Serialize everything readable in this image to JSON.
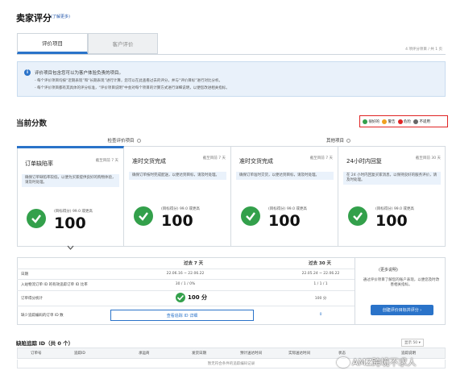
{
  "header": {
    "title": "卖家评分",
    "subtitle": "(了解更多)"
  },
  "tabs": [
    {
      "label": "评价项目"
    },
    {
      "label": "客户评价"
    }
  ],
  "meta_right": "4 项评分项目 / 共 1 页",
  "info": {
    "title": "评价项目包含您可以为客户体验负责的项目。",
    "lines": [
      "- 每个评价项目均按“近期表现”和“长期表现”进行计算，您可以在此查看过去的评分，并与“评价目标”进行对比分析。",
      "- 每个评价项目都有其具体的评分标准，“评价项目说明”中会对每个项目的计算方式进行详细说明，以便您改进相关指标。"
    ]
  },
  "section_title": "当前分数",
  "legend": [
    {
      "label": "很好的",
      "color": "#33a04b"
    },
    {
      "label": "警告",
      "color": "#f0a020"
    },
    {
      "label": "危险",
      "color": "#e02424"
    },
    {
      "label": "不适用",
      "color": "#666666"
    }
  ],
  "groups": [
    {
      "label": "检查评价项目"
    },
    {
      "label": "其他项目"
    }
  ],
  "cards": [
    {
      "name": "订单缺陷率",
      "target": "截至目前 7 天",
      "desc": "确保订单缺陷率较低，以便为买家提供良好的购物体验，请及时处理。",
      "score": "100",
      "score_caption": "(目标得分) 99.0 或更高"
    },
    {
      "name": "准时交货完成",
      "target": "截至目前 7 天",
      "desc": "确保订单按时完成配送，以便达到目标，请及时处理。",
      "score": "100",
      "score_caption": "(目标得分) 99.0 或更高"
    },
    {
      "name": "准时交货完成",
      "target": "截至目前 7 天",
      "desc": "确保订单准时交货，以便达到目标，请及时处理。",
      "score": "100",
      "score_caption": "(目标得分) 99.0 或更高"
    },
    {
      "name": "24小时内回复",
      "target": "截至目前 30 天",
      "desc": "在 24 小时内回复买家消息，以保持良好的服务评价，请及时处理。",
      "score": "100",
      "score_caption": "(目标得分) 99.0 或更高"
    }
  ],
  "table": {
    "col_headers": [
      "过去 7 天",
      "过去 30 天"
    ],
    "side_title": "(更多说明)",
    "side_desc": "通过评价项目了解您的账户表现，以便您及时改善相关指标。",
    "side_button": "创建评价目标并评分 ›",
    "rows": [
      {
        "label": "日期",
        "v7": "22.06.16 ~ 22.06.22",
        "v30": "22.05.24 ~ 22.06.22"
      },
      {
        "label": "入站物流订单 ID 的有效追踪订单 ID 比率",
        "v7": "30 / 1 / 0%",
        "v30": "1 / 1 / 1"
      },
      {
        "label": "订单得分统计",
        "v7": "100 分",
        "v30": "100 分"
      },
      {
        "label": "缺少追踪编码的订单 ID 数",
        "v7": "0",
        "v30": "0"
      }
    ],
    "link_button": "查看追踪 ID 详细"
  },
  "orders": {
    "title": "缺陷追踪 ID（共 0 个）",
    "page_size": "显示 50 ▾",
    "columns": [
      "订单号",
      "追踪ID",
      "承运商",
      "发货日期",
      "预计送达时间",
      "实际送达时间",
      "状态",
      "追踪说明"
    ],
    "empty": "暂无符合条件的追踪编码记录"
  },
  "watermark": "AMZ跨境不求人"
}
